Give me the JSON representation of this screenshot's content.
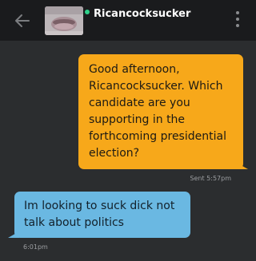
{
  "header": {
    "username": "Ricancocksucker",
    "back_icon": "arrow-left-icon",
    "more_icon": "more-vertical-icon",
    "online_color": "#2fd08a"
  },
  "messages": [
    {
      "direction": "outgoing",
      "text": "Good afternoon, Ricancocksucker. Which candidate are you supporting in the forthcoming presidential election?",
      "meta": "Sent 5:57pm",
      "color": "#f7a81a"
    },
    {
      "direction": "incoming",
      "text": "Im looking to suck dick not talk about politics",
      "meta": "6:01pm",
      "color": "#6ab8e2"
    }
  ]
}
